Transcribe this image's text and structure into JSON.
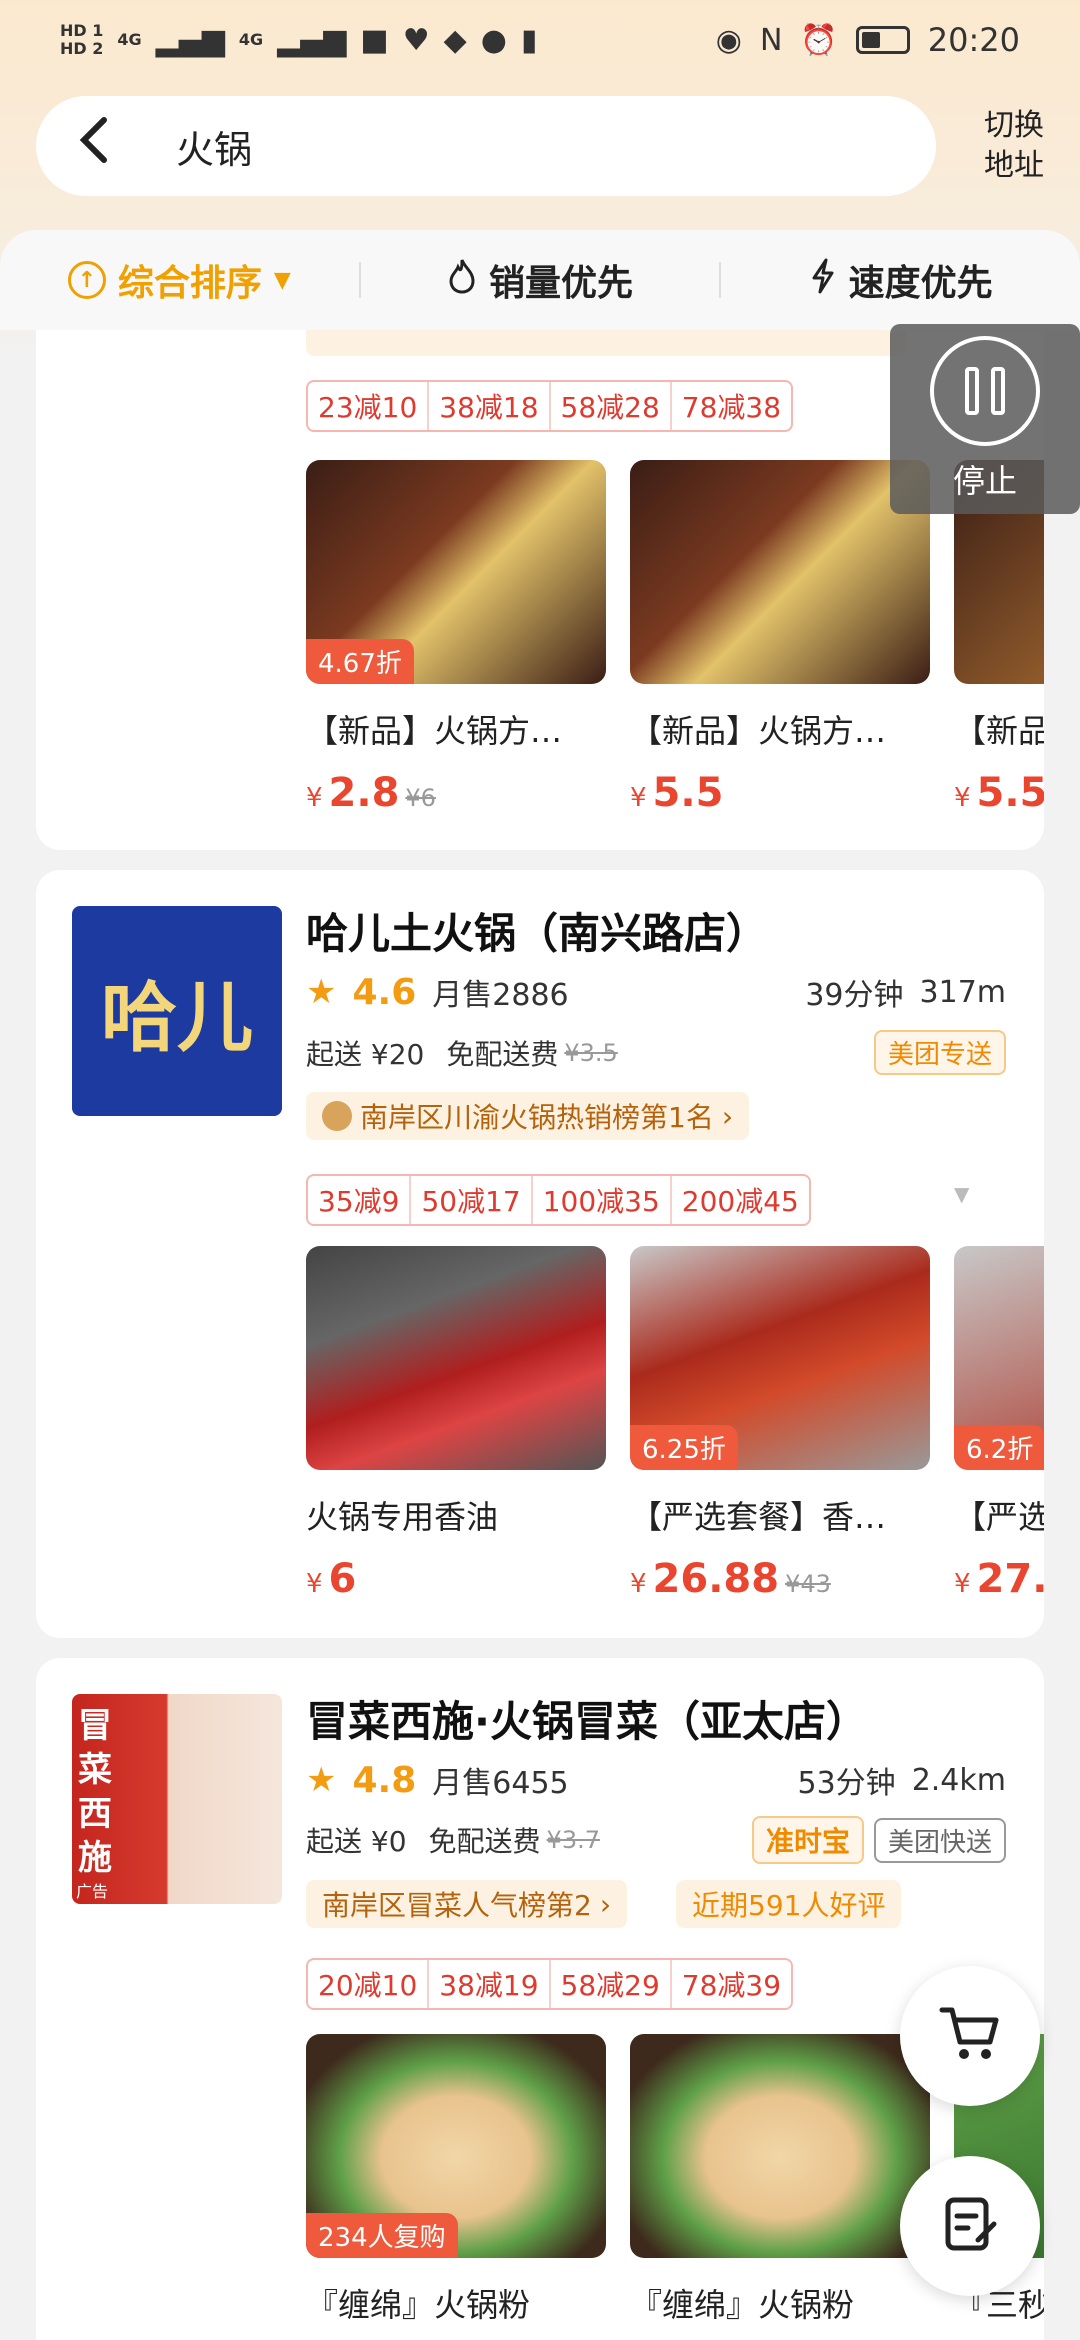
{
  "status_bar": {
    "time": "20:20",
    "sim1": "HD 1",
    "sim2": "HD 2",
    "net1": "4G",
    "net2": "4G"
  },
  "header": {
    "search_query": "火锅",
    "switch_address": "切换地址"
  },
  "sort_bar": {
    "items": [
      {
        "label": "综合排序",
        "icon": "up-arrow-circle-icon",
        "active": true
      },
      {
        "label": "销量优先",
        "icon": "flame-icon",
        "active": false
      },
      {
        "label": "速度优先",
        "icon": "lightning-icon",
        "active": false
      }
    ]
  },
  "float": {
    "stop_label": "停止"
  },
  "card_partial": {
    "discounts": [
      "23减10",
      "38减18",
      "58减28",
      "78减38"
    ],
    "dishes": [
      {
        "name": "【新品】火锅方…",
        "price": "2.8",
        "old_price": "¥6",
        "tag": "4.67折"
      },
      {
        "name": "【新品】火锅方…",
        "price": "5.5",
        "old_price": "",
        "tag": ""
      },
      {
        "name": "【新品",
        "price": "5.5",
        "old_price": "",
        "tag": ""
      }
    ]
  },
  "store1": {
    "logo_text": "哈儿",
    "name": "哈儿土火锅（南兴路店）",
    "rating": "4.6",
    "monthly_sales": "月售2886",
    "time": "39分钟",
    "distance": "317m",
    "min_order": "起送 ¥20",
    "delivery_fee": "免配送费",
    "old_fee": "¥3.5",
    "badge": "美团专送",
    "rank": "南岸区川渝火锅热销榜第1名",
    "discounts": [
      "35减9",
      "50减17",
      "100减35",
      "200减45"
    ],
    "dishes": [
      {
        "name": "火锅专用香油",
        "price": "6",
        "old_price": "",
        "tag": ""
      },
      {
        "name": "【严选套餐】香…",
        "price": "26.88",
        "old_price": "¥43",
        "tag": "6.25折"
      },
      {
        "name": "【严选",
        "price": "27.",
        "old_price": "",
        "tag": "6.2折"
      }
    ]
  },
  "store2": {
    "logo_text": "冒菜西施",
    "ad_label": "广告",
    "name": "冒菜西施·火锅冒菜（亚太店）",
    "rating": "4.8",
    "monthly_sales": "月售6455",
    "time": "53分钟",
    "distance": "2.4km",
    "min_order": "起送 ¥0",
    "delivery_fee": "免配送费",
    "old_fee": "¥3.7",
    "badge1": "准时宝",
    "badge2": "美团快送",
    "rank": "南岸区冒菜人气榜第2",
    "recent_reviews": "近期591人好评",
    "discounts": [
      "20减10",
      "38减19",
      "58减29",
      "78减39"
    ],
    "dishes": [
      {
        "name": "『缠绵』火锅粉",
        "tag": "234人复购"
      },
      {
        "name": "『缠绵』火锅粉",
        "tag": ""
      },
      {
        "name": "『三秒",
        "tag": ""
      }
    ]
  }
}
